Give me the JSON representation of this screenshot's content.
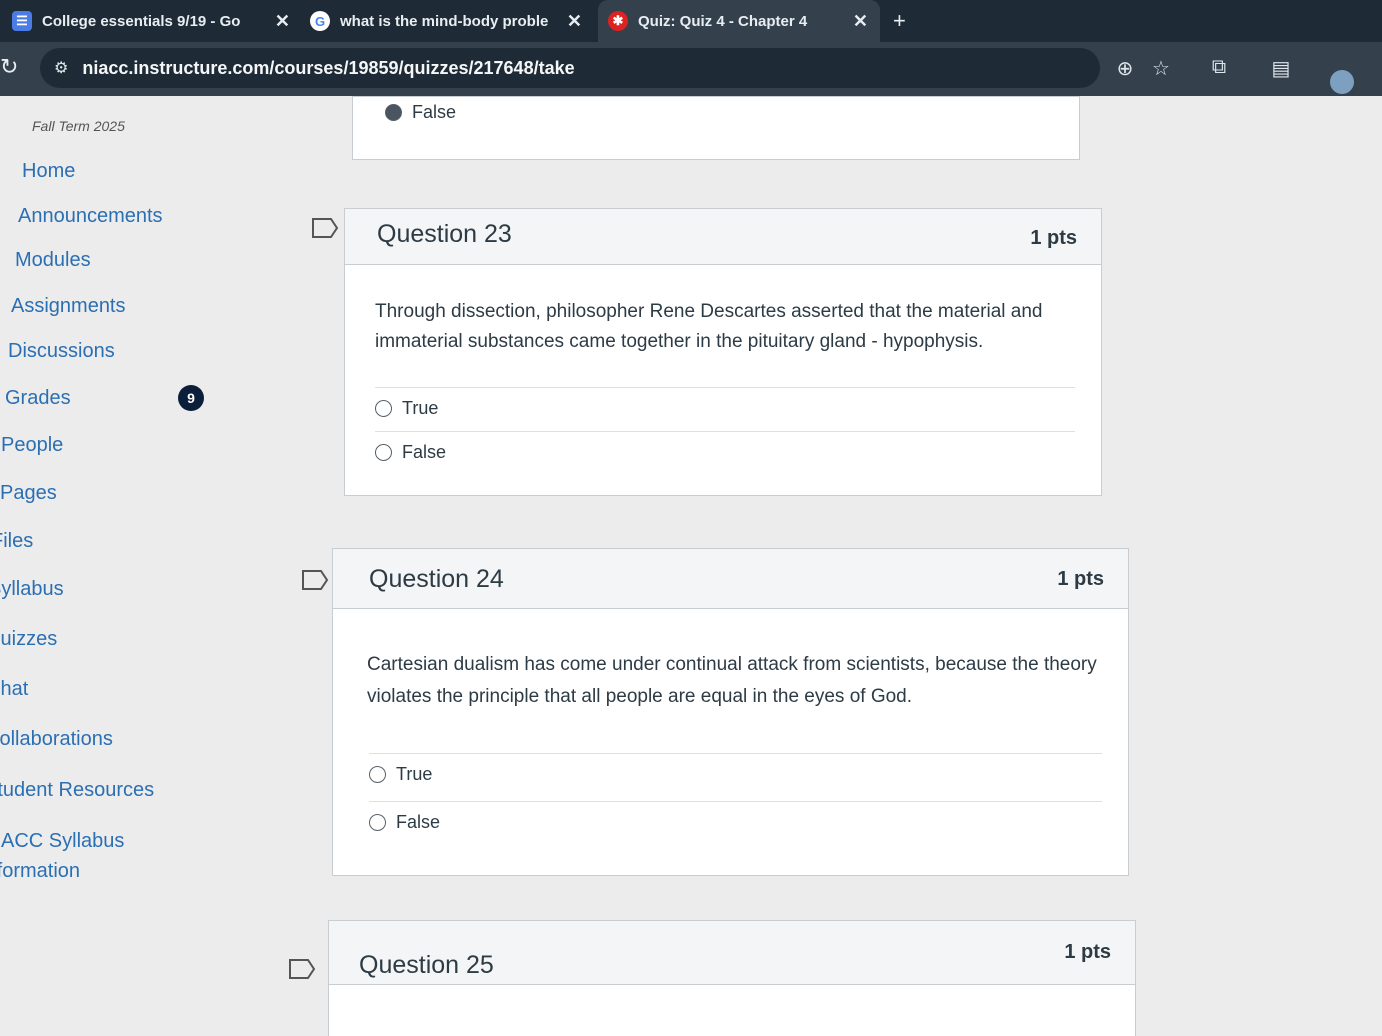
{
  "browser": {
    "tabs": [
      {
        "title": "College essentials 9/19 - Go"
      },
      {
        "title": "what is the mind-body proble"
      },
      {
        "title": "Quiz: Quiz 4 - Chapter 4"
      }
    ],
    "url": "niacc.instructure.com/courses/19859/quizzes/217648/take"
  },
  "sidebar": {
    "term": "Fall Term 2025",
    "items": [
      {
        "label": "Home"
      },
      {
        "label": "Announcements"
      },
      {
        "label": "Modules"
      },
      {
        "label": "Assignments"
      },
      {
        "label": "Discussions"
      },
      {
        "label": "Grades"
      },
      {
        "label": "People"
      },
      {
        "label": "Pages"
      },
      {
        "label": "Files"
      },
      {
        "label": "Syllabus"
      },
      {
        "label": "Quizzes"
      },
      {
        "label": "Chat"
      },
      {
        "label": "Collaborations"
      },
      {
        "label": "Student Resources"
      },
      {
        "label": "NIACC Syllabus"
      },
      {
        "label": "Information"
      }
    ],
    "grades_badge": "9"
  },
  "quiz": {
    "prev_answer": {
      "label": "False",
      "selected": true
    },
    "questions": [
      {
        "title": "Question 23",
        "points": "1 pts",
        "text": "Through dissection, philosopher Rene Descartes asserted that the material and immaterial substances came together in the pituitary gland - hypophysis.",
        "answers": [
          "True",
          "False"
        ]
      },
      {
        "title": "Question 24",
        "points": "1 pts",
        "text": "Cartesian dualism has come under continual attack from scientists, because the theory violates the principle that all people are equal in the eyes of God.",
        "answers": [
          "True",
          "False"
        ]
      },
      {
        "title": "Question 25",
        "points": "1 pts"
      }
    ]
  }
}
